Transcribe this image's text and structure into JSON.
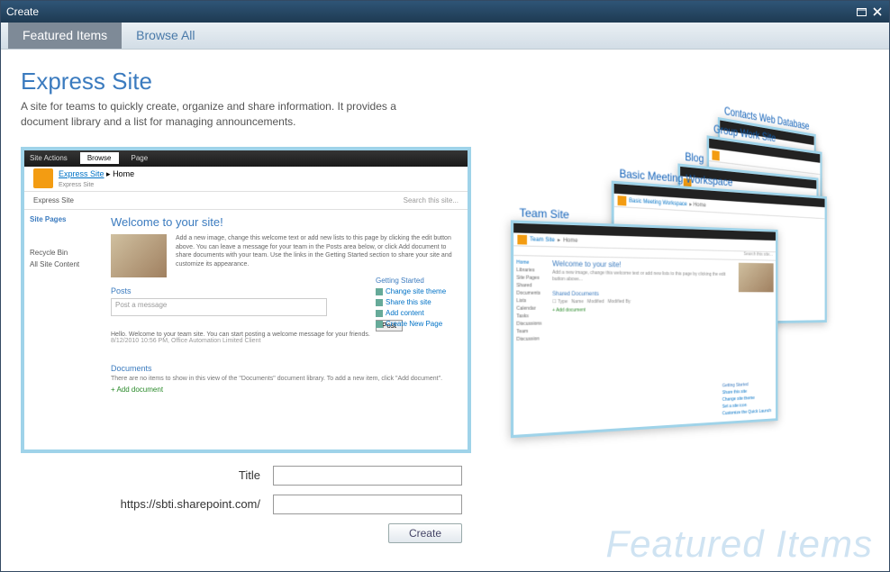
{
  "window": {
    "title": "Create"
  },
  "tabs": {
    "featured": "Featured Items",
    "browse": "Browse All"
  },
  "main": {
    "title": "Express Site",
    "description": "A site for teams to quickly create, organize and share information. It provides a document library and a list for managing announcements."
  },
  "preview": {
    "siteActions": "Site Actions",
    "browseTab": "Browse",
    "pageTab": "Page",
    "crumbLink": "Express Site",
    "crumbHome": "Home",
    "crumbSub": "Express Site",
    "bar2": "Express Site",
    "searchPlaceholder": "Search this site...",
    "sideHead": "Site Pages",
    "recycle": "Recycle Bin",
    "allContent": "All Site Content",
    "welcome": "Welcome to your site!",
    "welcomeText": "Add a new image, change this welcome text or add new lists to this page by clicking the edit button above. You can leave a message for your team in the Posts area below, or click Add document to share documents with your team. Use the links in the Getting Started section to share your site and customize its appearance.",
    "postsHead": "Posts",
    "postMsg": "Post a message",
    "postBtn": "Post",
    "hello": "Hello. Welcome to your team site. You can start posting a welcome message for your friends.",
    "helloMeta": "8/12/2010 10:56 PM, Office Automation Limited Client",
    "startedHead": "Getting Started",
    "s1": "Change site theme",
    "s2": "Share this site",
    "s3": "Add content",
    "s4": "Create New Page",
    "docsHead": "Documents",
    "docsLine": "There are no items to show in this view of the \"Documents\" document library. To add a new item, click \"Add document\".",
    "addDoc": "+ Add document"
  },
  "form": {
    "titleLabel": "Title",
    "urlLabel": "https://sbti.sharepoint.com/",
    "createBtn": "Create"
  },
  "carousel": {
    "c1": "Team Site",
    "c2": "Basic Meeting Workspace",
    "c3": "Blog",
    "c4": "Group Work Site",
    "c5": "Contacts Web Database",
    "team": {
      "crumb": "Team Site",
      "home": "Home",
      "search": "Search this site...",
      "sideLib": "Libraries",
      "sidePages": "Site Pages",
      "sideShared": "Shared Documents",
      "sideLists": "Lists",
      "sideCal": "Calendar",
      "sideTasks": "Tasks",
      "sideDisc": "Discussions",
      "sideTeam": "Team Discussion",
      "welcome": "Welcome to your site!",
      "shdoc": "Shared Documents",
      "addDoc": "+ Add document",
      "gsHead": "Getting Started",
      "gs1": "Share this site",
      "gs2": "Change site theme",
      "gs3": "Set a site icon",
      "gs4": "Customize the Quick Launch"
    }
  },
  "watermark": "Featured Items"
}
